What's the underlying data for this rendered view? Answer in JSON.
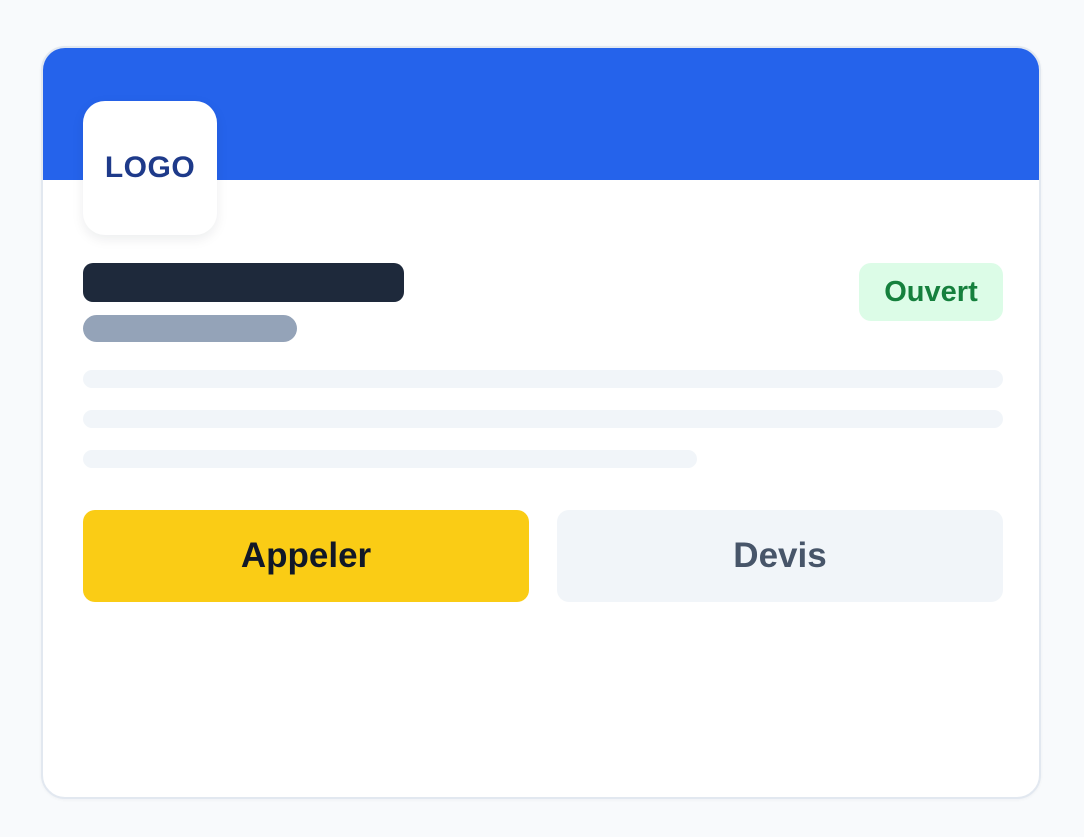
{
  "card": {
    "logo_label": "LOGO",
    "status_badge": "Ouvert",
    "actions": {
      "call_label": "Appeler",
      "quote_label": "Devis"
    }
  },
  "colors": {
    "header": "#2563eb",
    "logo_text": "#1e3a8a",
    "title_placeholder": "#1e293b",
    "subtitle_placeholder": "#94a3b8",
    "text_placeholder": "#f1f5f9",
    "status_bg": "#dcfce7",
    "status_text": "#15803d",
    "call_button": "#facc15",
    "quote_button": "#f1f5f9",
    "page_background": "#f8fafc"
  }
}
